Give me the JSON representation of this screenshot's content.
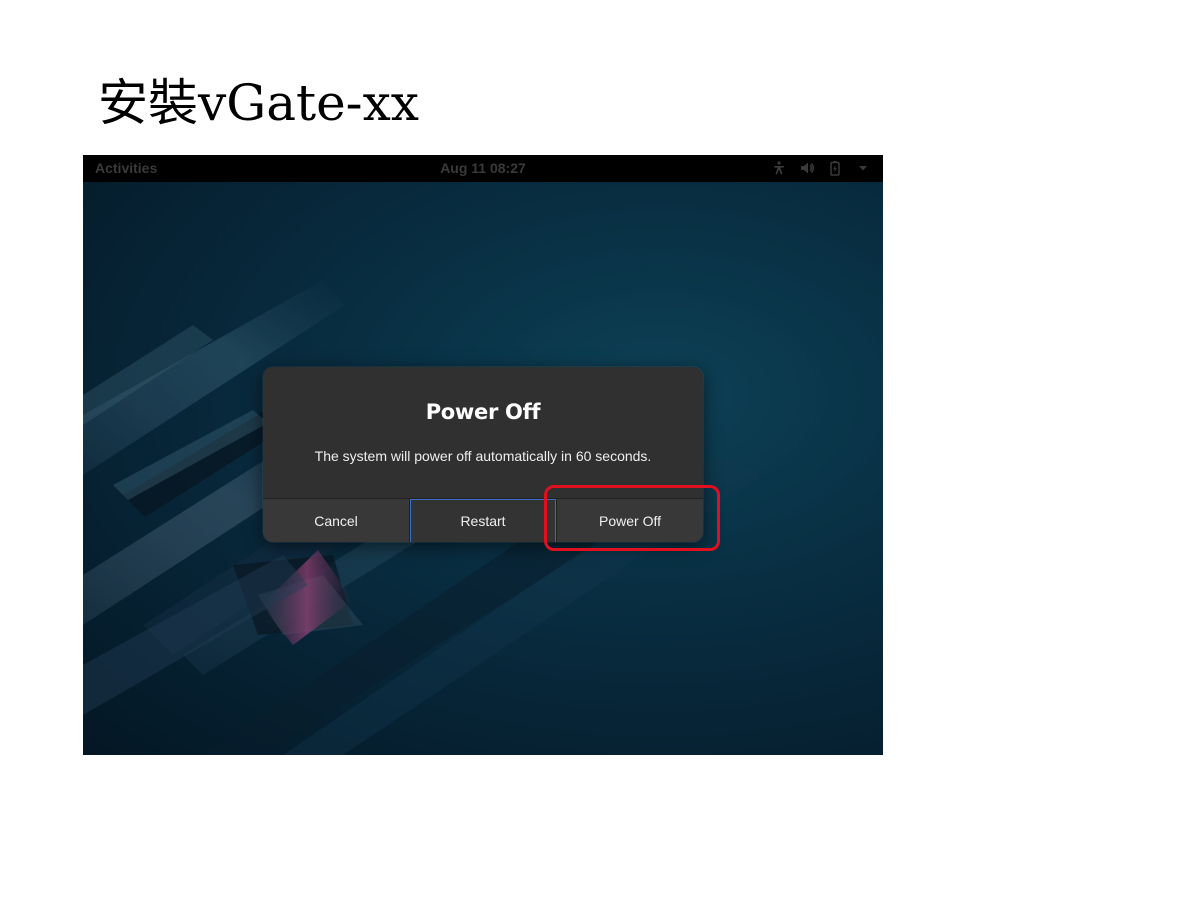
{
  "slide": {
    "title": "安裝vGate-xx"
  },
  "topbar": {
    "activities_label": "Activities",
    "clock": "Aug 11  08:27",
    "tray_icons": [
      "accessibility-icon",
      "volume-icon",
      "battery-icon",
      "system-menu-arrow-icon"
    ]
  },
  "dialog": {
    "title": "Power Off",
    "message": "The system will power off automatically in 60 seconds.",
    "buttons": {
      "cancel": "Cancel",
      "restart": "Restart",
      "power_off": "Power Off"
    },
    "focused_button": "restart"
  },
  "annotation": {
    "highlight_target": "power_off",
    "color": "#e0101e"
  },
  "colors": {
    "dialog_bg": "#303030",
    "topbar_bg": "#000000",
    "focus_ring": "#3a6cc4"
  }
}
